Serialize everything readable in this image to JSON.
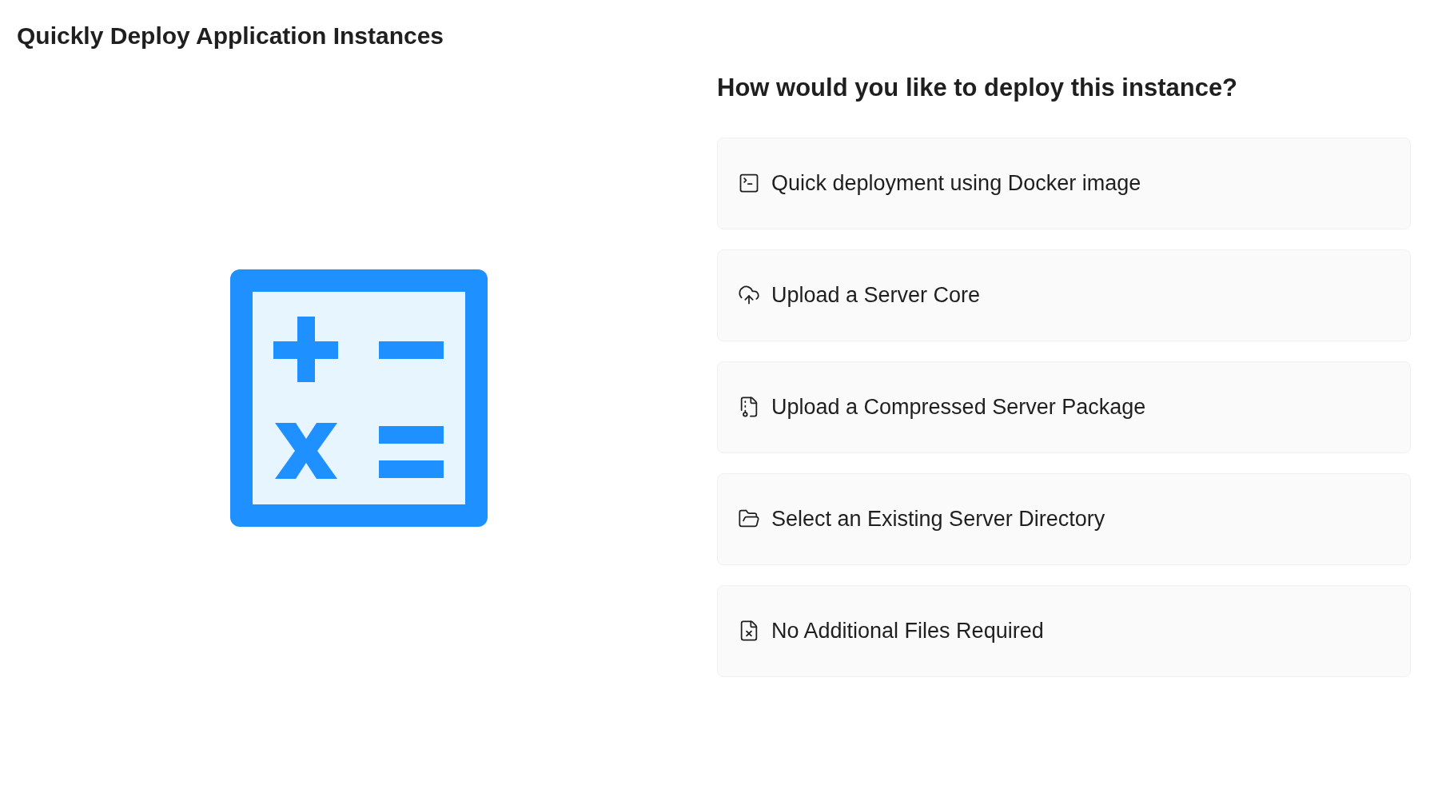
{
  "page": {
    "title": "Quickly Deploy Application Instances"
  },
  "question": "How would you like to deploy this instance?",
  "options": [
    {
      "kind": "terminal",
      "label": "Quick deployment using Docker image"
    },
    {
      "kind": "cloud-upload",
      "label": "Upload a Server Core"
    },
    {
      "kind": "archive",
      "label": "Upload a Compressed Server Package"
    },
    {
      "kind": "folder",
      "label": "Select an Existing Server Directory"
    },
    {
      "kind": "no-file",
      "label": "No Additional Files Required"
    }
  ]
}
